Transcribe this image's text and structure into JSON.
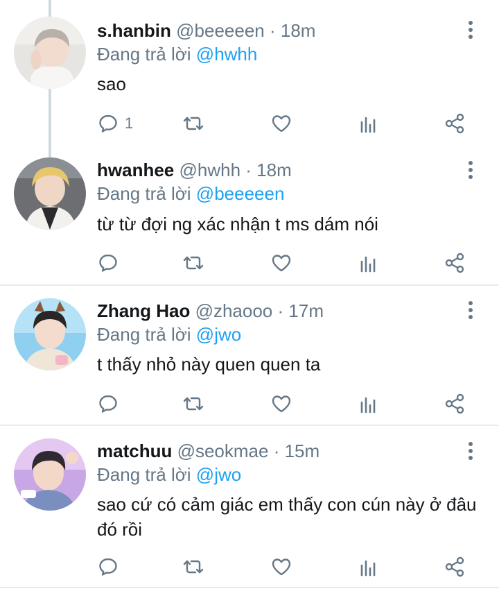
{
  "tweets": [
    {
      "name": "s.hanbin",
      "handle": "@beeeeen",
      "time": "· 18m",
      "replying_prefix": "Đang trả lời",
      "replying_to": "@hwhh",
      "text": "sao",
      "reply_count": "1"
    },
    {
      "name": "hwanhee",
      "handle": "@hwhh",
      "time": "· 18m",
      "replying_prefix": "Đang trả lời",
      "replying_to": "@beeeeen",
      "text": "từ từ đợi ng xác nhận t ms dám nói",
      "reply_count": ""
    },
    {
      "name": "Zhang Hao",
      "handle": "@zhaooo",
      "time": "· 17m",
      "replying_prefix": "Đang trả lời",
      "replying_to": "@jwo",
      "text": "t thấy nhỏ này quen quen ta",
      "reply_count": ""
    },
    {
      "name": "matchuu",
      "handle": "@seokmae",
      "time": "· 15m",
      "replying_prefix": "Đang trả lời",
      "replying_to": "@jwo",
      "text": "sao cứ có cảm giác em thấy con cún này ở đâu đó rồi",
      "reply_count": ""
    }
  ],
  "icons": {
    "reply": "reply-icon",
    "retweet": "retweet-icon",
    "like": "heart-icon",
    "analytics": "analytics-icon",
    "share": "share-icon",
    "more": "more-options-icon"
  },
  "colors": {
    "mention": "#1da1f2",
    "secondary_text": "#657786",
    "thread_line": "#cfd9de"
  }
}
